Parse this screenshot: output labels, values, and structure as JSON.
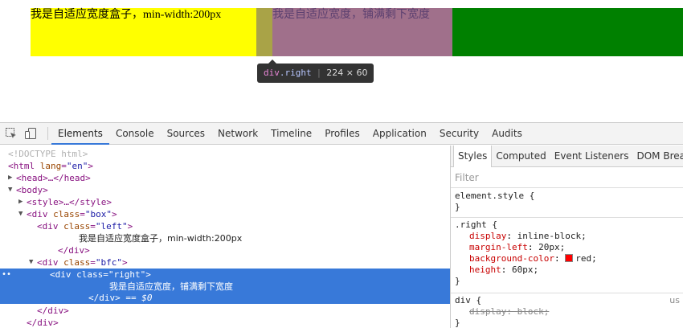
{
  "viewport": {
    "left_text": "我是自适应宽度盒子，min-width:200px",
    "right_text": "我是自适应宽度，铺满剩下宽度",
    "colors": {
      "left": "#ffff00",
      "margin": "#a9a347",
      "right": "#a0708b",
      "rest": "#008000"
    }
  },
  "tooltip": {
    "tag": "div",
    "class": ".right",
    "dimensions": "224 × 60"
  },
  "toolbar": {
    "icons": [
      "inspect-icon",
      "device-mode-icon"
    ],
    "tabs": [
      "Elements",
      "Console",
      "Sources",
      "Network",
      "Timeline",
      "Profiles",
      "Application",
      "Security",
      "Audits"
    ],
    "active_tab": "Elements"
  },
  "dom": {
    "doctype": "<!DOCTYPE html>",
    "html_open_tag": "<html",
    "html_attr": "lang",
    "html_val": "\"en\"",
    "head": "<head>…</head>",
    "body_open": "<body>",
    "style": "<style>…</style>",
    "box_tag": "<div",
    "box_attr": "class",
    "box_val": "\"box\"",
    "left_tag": "<div",
    "left_attr": "class",
    "left_val": "\"left\"",
    "left_text": "我是自适应宽度盒子，min-width:200px",
    "left_close": "</div>",
    "bfc_tag": "<div",
    "bfc_attr": "class",
    "bfc_val": "\"bfc\"",
    "right_tag": "<div",
    "right_attr": "class",
    "right_val": "\"right\"",
    "right_text": "我是自适应宽度，铺满剩下宽度",
    "right_close": "</div>",
    "right_eq": "== $0",
    "bfc_close": "</div>",
    "box_close": "</div>",
    "selected_marker": "••"
  },
  "styles_panel": {
    "subtabs": [
      "Styles",
      "Computed",
      "Event Listeners",
      "DOM Breakpoints"
    ],
    "active_subtab": "Styles",
    "filter_placeholder": "Filter",
    "element_style_selector": "element.style {",
    "element_style_close": "}",
    "right_rule": {
      "selector": ".right {",
      "props": [
        {
          "name": "display",
          "value": "inline-block;"
        },
        {
          "name": "margin-left",
          "value": "20px;"
        },
        {
          "name": "background-color",
          "value": "red;",
          "swatch": "#ff0000"
        },
        {
          "name": "height",
          "value": "60px;"
        }
      ],
      "close": "}"
    },
    "div_rule": {
      "selector": "div {",
      "origin": "us",
      "props": [
        {
          "name": "display",
          "value": "block;"
        }
      ],
      "close": "}"
    }
  }
}
